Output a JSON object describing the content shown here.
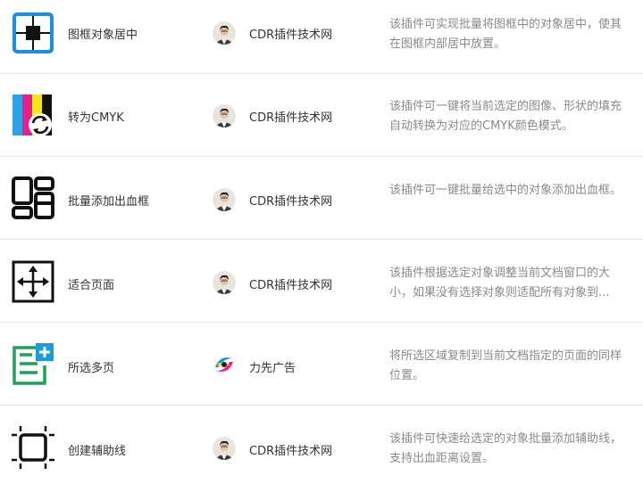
{
  "plugins": [
    {
      "name": "图框对象居中",
      "icon": "center-frame-icon",
      "author": "CDR插件技术网",
      "avatar": "author-avatar-person",
      "description": "该插件可实现批量将图框中的对象居中，使其在图框内部居中放置。"
    },
    {
      "name": "转为CMYK",
      "icon": "cmyk-convert-icon",
      "author": "CDR插件技术网",
      "avatar": "author-avatar-person",
      "description": "该插件可一键将当前选定的图像、形状的填充自动转换为对应的CMYK颜色模式。"
    },
    {
      "name": "批量添加出血框",
      "icon": "bleed-frame-icon",
      "author": "CDR插件技术网",
      "avatar": "author-avatar-person",
      "description": "该插件可一键批量给选中的对象添加出血框。"
    },
    {
      "name": "适合页面",
      "icon": "fit-page-icon",
      "author": "CDR插件技术网",
      "avatar": "author-avatar-person",
      "description": "该插件根据选定对象调整当前文档窗口的大小，如果没有选择对象则适配所有对象到..."
    },
    {
      "name": "所选多页",
      "icon": "multi-page-icon",
      "author": "力先广告",
      "avatar": "author-avatar-logo",
      "description": "将所选区域复制到当前文档指定的页面的同样位置。"
    },
    {
      "name": "创建辅助线",
      "icon": "guideline-icon",
      "author": "CDR插件技术网",
      "avatar": "author-avatar-person",
      "description": "该插件可快速给选定的对象批量添加辅助线，支持出血距离设置。"
    }
  ]
}
